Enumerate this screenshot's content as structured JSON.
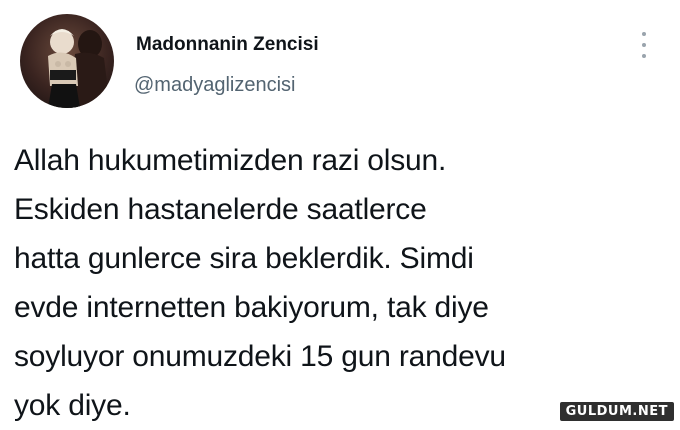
{
  "tweet": {
    "display_name": "Madonnanin Zencisi",
    "handle": "@madyaglizencisi",
    "text": "Allah hukumetimizden razi olsun.\nEskiden hastanelerde saatlerce\nhatta gunlerce sira beklerdik. Simdi\nevde internetten bakiyorum, tak diye\nsoyluyor onumuzdeki 15 gun randevu\nyok diye.",
    "more_icon": "more-vertical-icon"
  },
  "watermark": {
    "text": "GULDUM.NET"
  },
  "colors": {
    "name": "#0f1419",
    "handle": "#536471",
    "text": "#0f1419",
    "background": "#ffffff"
  }
}
